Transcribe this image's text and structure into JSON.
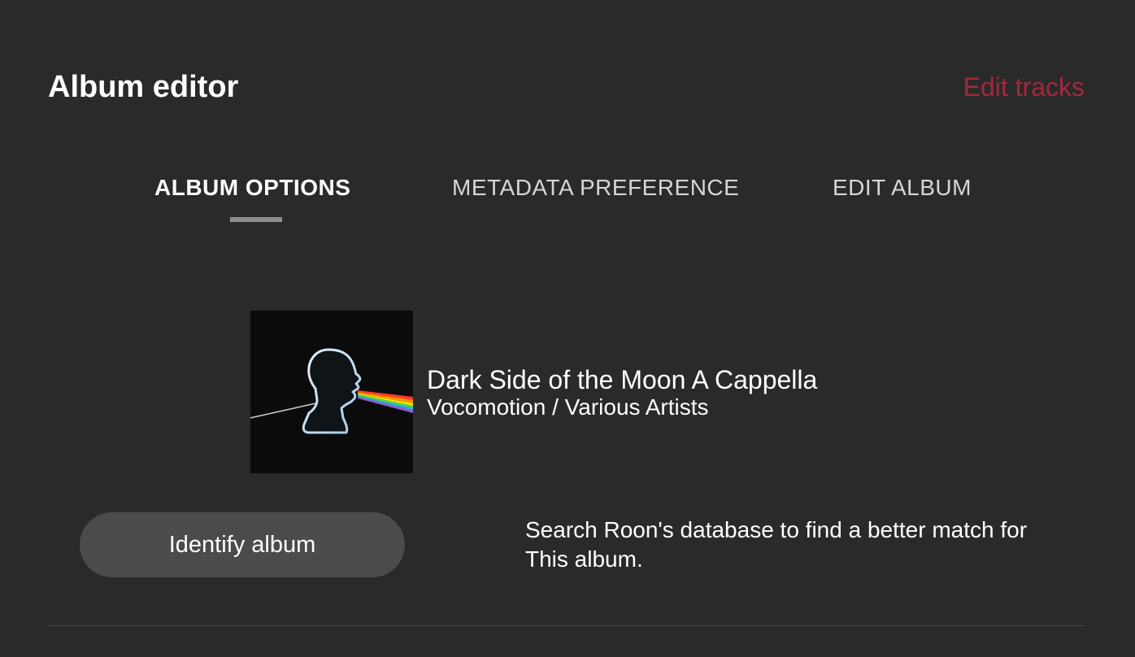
{
  "header": {
    "title": "Album editor",
    "edit_tracks_label": "Edit tracks",
    "accent_color": "#a5283a"
  },
  "tabs": [
    {
      "label": "ALBUM OPTIONS",
      "active": true
    },
    {
      "label": "METADATA PREFERENCE",
      "active": false
    },
    {
      "label": "EDIT ALBUM",
      "active": false
    }
  ],
  "album": {
    "title": "Dark Side of the Moon A Cappella",
    "artist": "Vocomotion / Various Artists",
    "cover_icon": "album-cover-head-prism"
  },
  "identify": {
    "button_label": "Identify album",
    "description": "Search Roon's database to find a better match for This album."
  },
  "colors": {
    "background": "#2a2a2a",
    "button_background": "#4b4b4d",
    "tab_indicator": "#8e8e8e"
  }
}
